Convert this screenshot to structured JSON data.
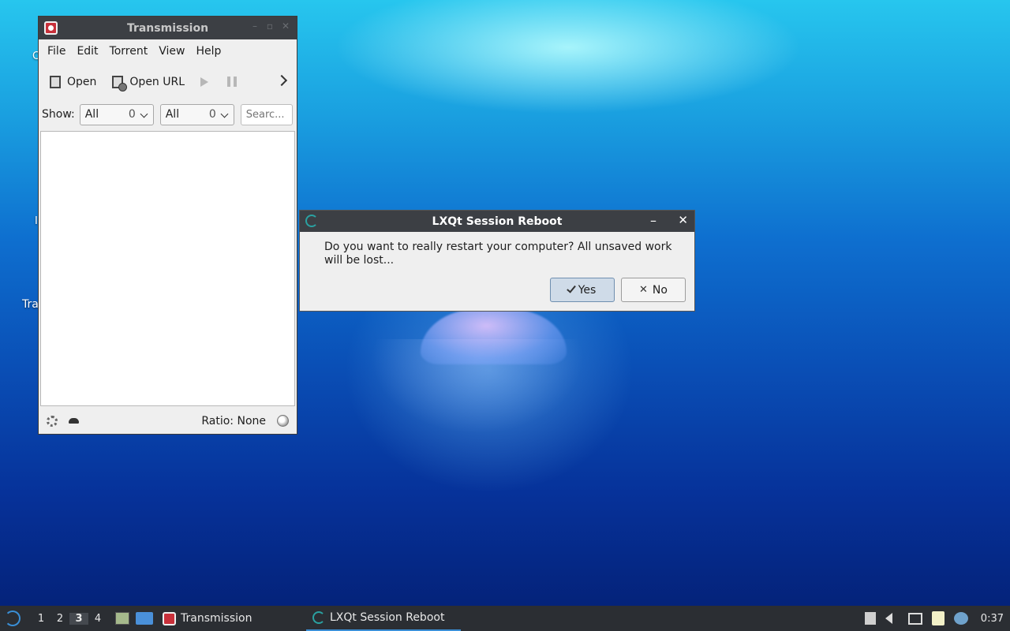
{
  "desktop": {
    "partial_label_1": "Tra",
    "partial_label_2": "C",
    "partial_label_3": "I"
  },
  "transmission": {
    "title": "Transmission",
    "menu": [
      "File",
      "Edit",
      "Torrent",
      "View",
      "Help"
    ],
    "toolbar": {
      "open_label": "Open",
      "open_url_label": "Open URL"
    },
    "filter": {
      "show_label": "Show:",
      "activity": {
        "value": "All",
        "count": "0"
      },
      "tracker": {
        "value": "All",
        "count": "0"
      },
      "search_placeholder": "Searc..."
    },
    "status": {
      "ratio": "Ratio: None"
    }
  },
  "dialog": {
    "title": "LXQt Session Reboot",
    "message": "Do you want to really restart your computer? All unsaved work will be lost...",
    "yes_label": "Yes",
    "no_label": "No",
    "close_glyph": "✕",
    "min_glyph": "–"
  },
  "taskbar": {
    "workspaces": [
      "1",
      "2",
      "3",
      "4"
    ],
    "active_workspace": "3",
    "tasks": [
      "Transmission",
      "LXQt Session Reboot"
    ],
    "clock": "0:37"
  }
}
